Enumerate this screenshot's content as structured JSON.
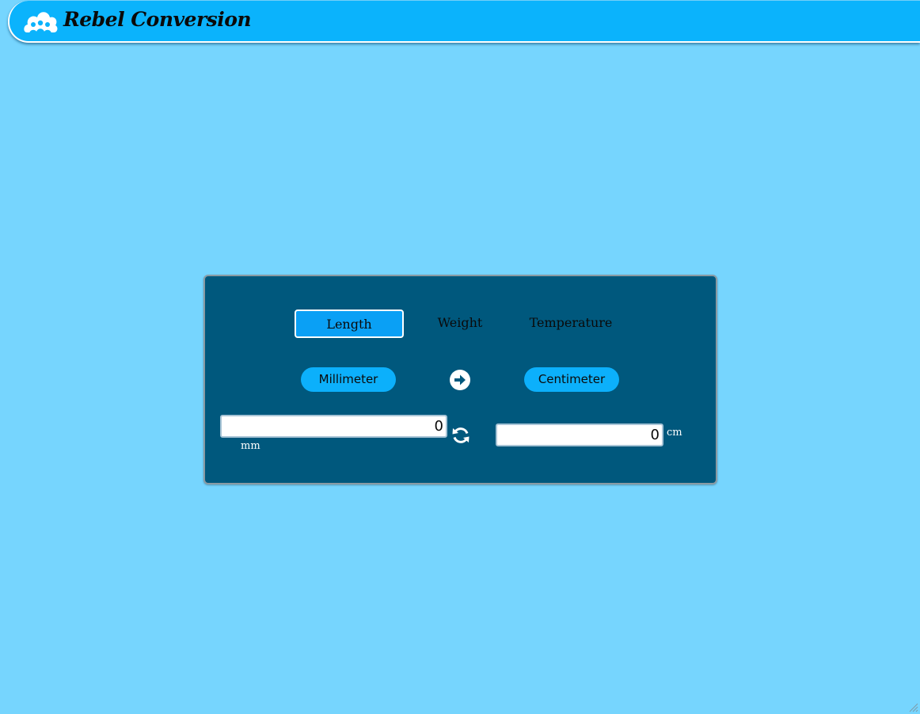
{
  "header": {
    "brand_name": "Rebel Conversion",
    "logo_icon": "cloud-people-logo-icon"
  },
  "tabs": [
    {
      "label": "Length",
      "active": true
    },
    {
      "label": "Weight",
      "active": false
    },
    {
      "label": "Temperature",
      "active": false
    }
  ],
  "converter": {
    "from_unit": "Millimeter",
    "to_unit": "Centimeter",
    "from_value": "0",
    "to_value": "0",
    "from_abbr": "mm",
    "to_abbr": "cm",
    "direction_icon": "arrow-right-circle-icon",
    "swap_icon": "refresh-swap-icon"
  },
  "colors": {
    "page_background": "#76d5fe",
    "header_background": "#0bb3fc",
    "panel_background": "#00587d",
    "active_tab": "#0aa0f5",
    "unit_pill": "#0cb0fb"
  }
}
